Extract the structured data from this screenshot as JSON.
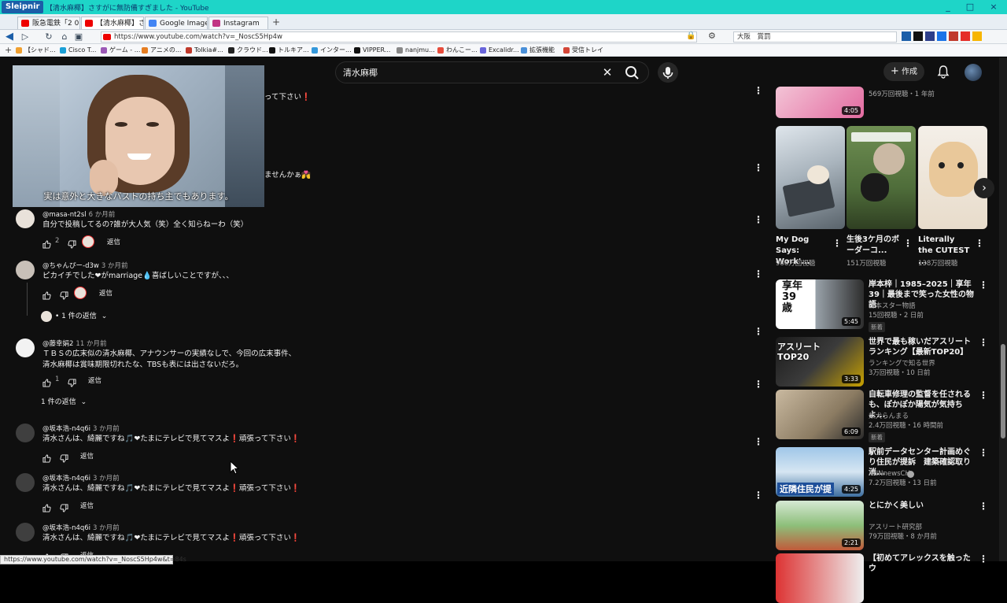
{
  "window": {
    "app": "Sleipnir",
    "title": "【清水麻椰】さすがに無防備すぎました - YouTube",
    "controls": [
      "_",
      "□",
      "×"
    ]
  },
  "tabs": [
    {
      "label": "阪急電鉄「2 0...",
      "color": "#e00"
    },
    {
      "label": "【清水麻椰】さす...",
      "color": "#e00",
      "active": true
    },
    {
      "label": "Google Image R...",
      "color": "#4285f4"
    },
    {
      "label": "Instagram",
      "color": "#c13584"
    }
  ],
  "address": {
    "url": "https://www.youtube.com/watch?v=_NoscS5Hp4w",
    "search_value": "大阪　賞罰"
  },
  "bookmarks": [
    {
      "label": "【シャド...",
      "color": "#f0a030"
    },
    {
      "label": "Cisco T...",
      "color": "#1ba0d7"
    },
    {
      "label": "ゲーム - ...",
      "color": "#9b59b6"
    },
    {
      "label": "アニメの...",
      "color": "#e67e22"
    },
    {
      "label": "Tolkia#...",
      "color": "#c0392b"
    },
    {
      "label": "クラウド...",
      "color": "#222"
    },
    {
      "label": "トルキア...",
      "color": "#111"
    },
    {
      "label": "インター...",
      "color": "#3498db"
    },
    {
      "label": "VIPPER...",
      "color": "#111"
    },
    {
      "label": "nanjmu...",
      "color": "#888"
    },
    {
      "label": "わんこー...",
      "color": "#e74c3c"
    },
    {
      "label": "Excalidr...",
      "color": "#6965db"
    },
    {
      "label": "拡張機能",
      "color": "#4a90d9"
    },
    {
      "label": "受信トレイ",
      "color": "#d44638"
    }
  ],
  "youtube": {
    "search_query": "清水麻椰",
    "create_label": "作成"
  },
  "overlay": {
    "caption": "実は意外と大きなバストの持ち主でもあります。"
  },
  "partial_texts": [
    "って下さい",
    "ませんかぁ"
  ],
  "comments": [
    {
      "author": "@masa-nt2sl",
      "time": "6 か月前",
      "text": "自分で投稿してるの?誰が大人気（笑）全く知らねーわ（笑）",
      "likes": "2",
      "reply": "返信"
    },
    {
      "author": "@ちゃんぴー-d3w",
      "time": "3 か月前",
      "text": "ピカイチでした❤がmarriage💧喜ばしいことですが、、、",
      "likes": "",
      "reply": "返信",
      "replies_label": "• 1 件の返信"
    },
    {
      "author": "@藤幸娟2",
      "time": "11 か月前",
      "text": "ＴＢＳの広末似の清水麻椰、アナウンサーの実績なしで、今回の広末事件、",
      "text2": "清水麻椰は賞味期限切れたな、TBSも表には出さないだろ。",
      "likes": "1",
      "reply": "返信",
      "replies_label": "1 件の返信"
    },
    {
      "author": "@坂本浩-n4q6i",
      "time": "3 か月前",
      "text": "清水さんは、綺麗ですね🎵❤たまにテレビで見てマスよ❗頑張って下さい❗",
      "likes": "",
      "reply": "返信"
    },
    {
      "author": "@坂本浩-n4q6i",
      "time": "3 か月前",
      "text": "清水さんは、綺麗ですね🎵❤たまにテレビで見てマスよ❗頑張って下さい❗",
      "likes": "",
      "reply": "返信"
    },
    {
      "author": "@坂本浩-n4q6i",
      "time": "3 か月前",
      "text": "清水さんは、綺麗ですね🎵❤たまにテレビで見てマスよ❗頑張って下さい❗",
      "likes": "",
      "reply": "返信"
    }
  ],
  "rail": {
    "top_partial": {
      "duration": "4:05",
      "stats": "569万回視聴・1 年前"
    },
    "shorts": [
      {
        "title": "My Dog Says: Work'...",
        "views": "988万回視聴"
      },
      {
        "title": "生後3ケ月のボーダーコ...",
        "views": "151万回視聴"
      },
      {
        "title": "Literally the CUTEST ...",
        "views": "138万回視聴"
      }
    ],
    "videos": [
      {
        "title": "岸本梓｜1985–2025｜享年39｜最後まで笑った女性の物語",
        "channel": "日本スター物語",
        "stats": "15回視聴・2 日前",
        "badge": "新着",
        "duration": "5:45",
        "thumb_text": "享年39歳"
      },
      {
        "title": "世界で最も稼いだアスリートランキング【最新TOP20】",
        "channel": "ランキングで知る世界",
        "stats": "3万回視聴・10 日前",
        "badge": "",
        "duration": "3:33",
        "thumb_text": "アスリートTOP20"
      },
      {
        "title": "自転車修理の監督を任されるも、ぽかぽか陽気が気持ちよ...",
        "channel": "柴犬らんまる",
        "stats": "2.4万回視聴・16 時間前",
        "badge": "新着",
        "duration": "6:09",
        "thumb_text": ""
      },
      {
        "title": "駅前データセンター計画めぐり住民が提訴　建築確認取り消...",
        "channel": "ANNnewsCH",
        "stats": "7.2万回視聴・13 日前",
        "badge": "",
        "duration": "4:25",
        "thumb_text": "近隣住民が提"
      },
      {
        "title": "とにかく美しい",
        "channel": "アスリート研究部",
        "stats": "79万回視聴・8 か月前",
        "badge": "",
        "duration": "2:21",
        "thumb_text": ""
      },
      {
        "title": "【初めてアレックスを触ったウ",
        "channel": "",
        "stats": "",
        "badge": "",
        "duration": "",
        "thumb_text": ""
      }
    ]
  },
  "status_url": "https://www.youtube.com/watch?v=_NoscS5Hp4w&t=84s"
}
